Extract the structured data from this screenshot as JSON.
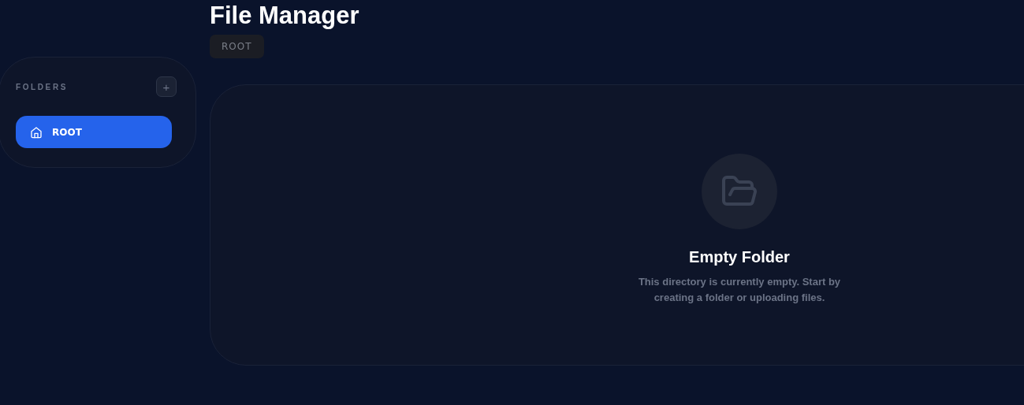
{
  "page": {
    "title": "File Manager"
  },
  "breadcrumb": [
    {
      "label": "ROOT"
    }
  ],
  "sidebar": {
    "heading": "FOLDERS",
    "add_button": "+",
    "items": [
      {
        "label": "ROOT",
        "selected": true
      }
    ]
  },
  "empty_state": {
    "title": "Empty Folder",
    "message": "This directory is currently empty. Start by creating a folder or uploading files."
  }
}
